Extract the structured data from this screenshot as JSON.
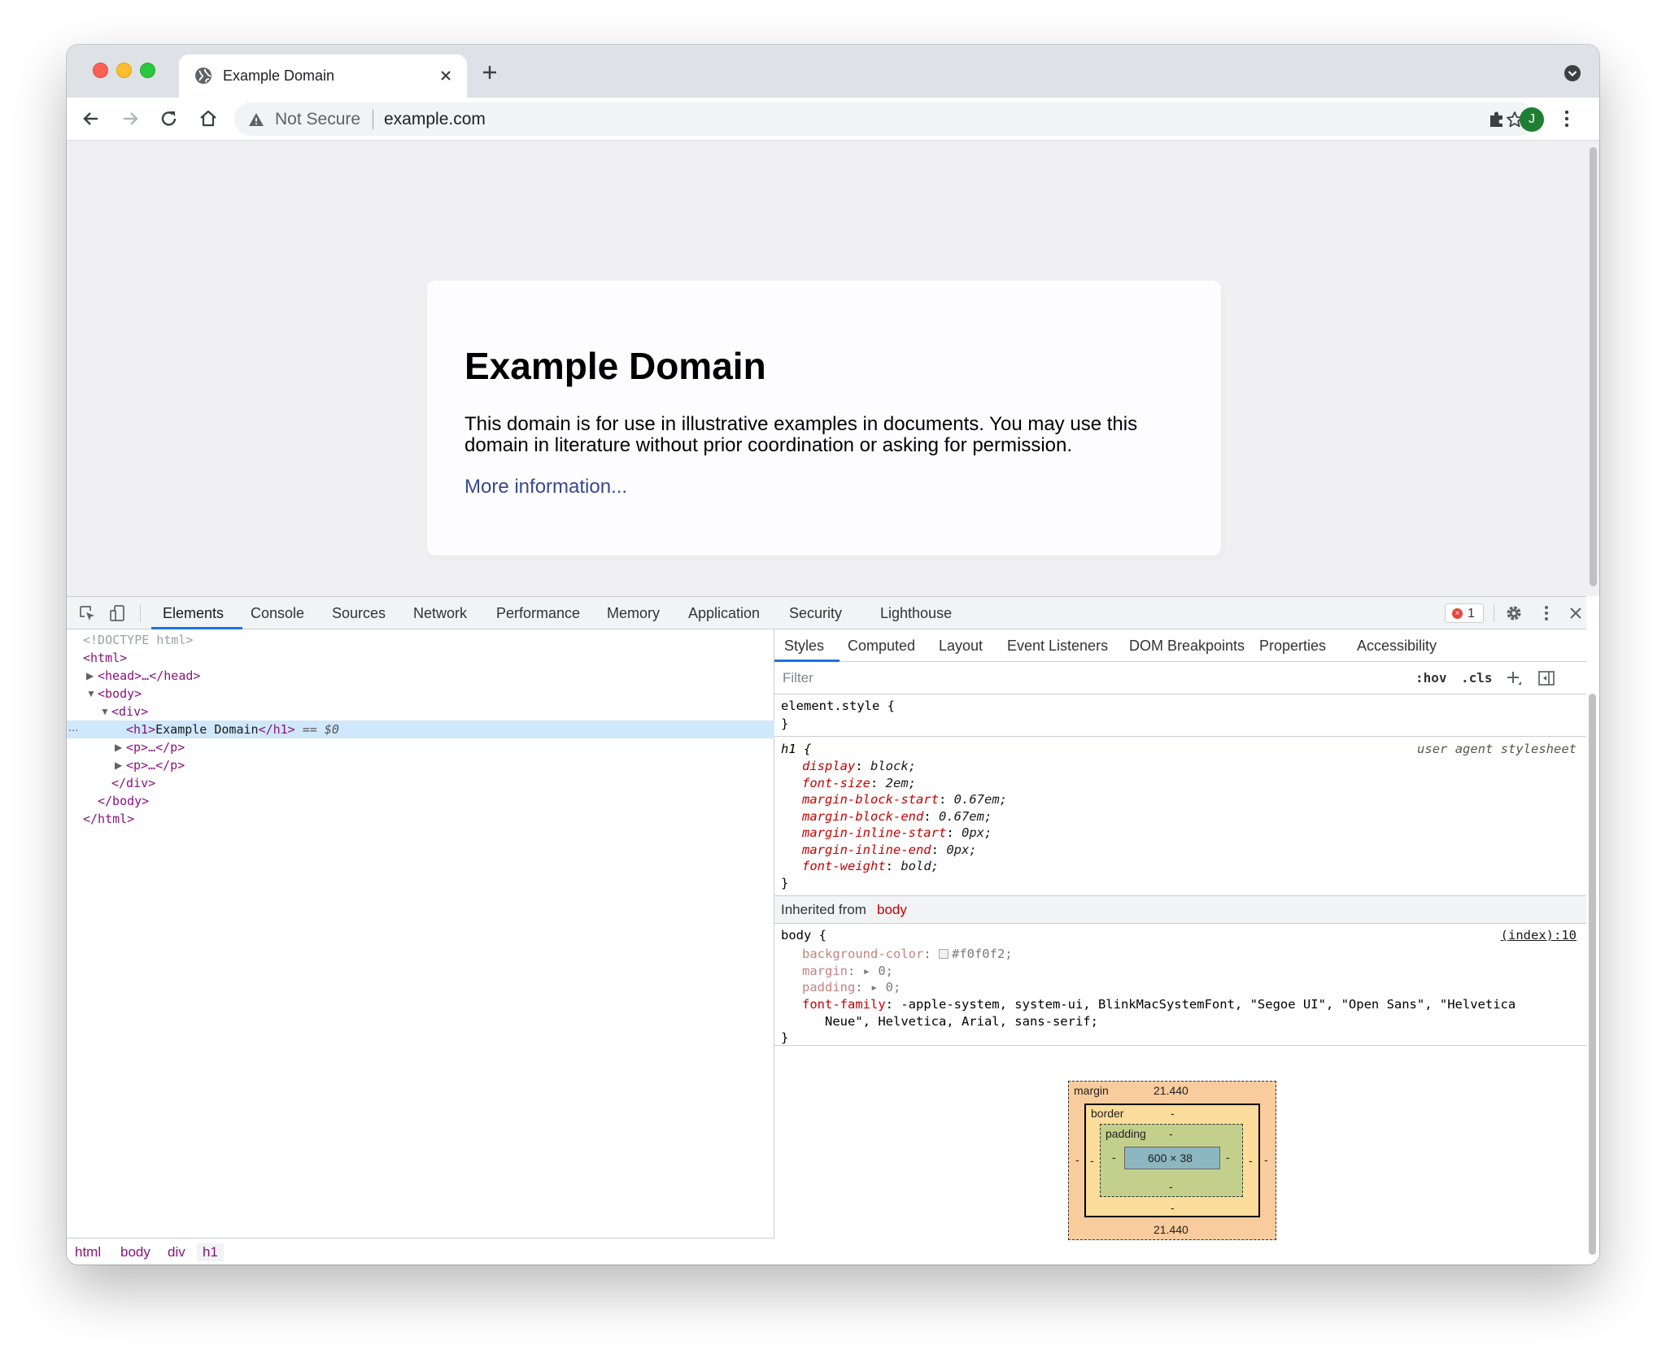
{
  "browser": {
    "tab_title": "Example Domain",
    "security_label": "Not Secure",
    "url": "example.com",
    "profile_initial": "J"
  },
  "page": {
    "heading": "Example Domain",
    "paragraph": "This domain is for use in illustrative examples in documents. You may use this domain in literature without prior coordination or asking for permission.",
    "link_text": "More information..."
  },
  "devtools": {
    "tabs": [
      "Elements",
      "Console",
      "Sources",
      "Network",
      "Performance",
      "Memory",
      "Application",
      "Security",
      "Lighthouse"
    ],
    "active_tab": "Elements",
    "error_count": "1",
    "dom": {
      "doctype": "<!DOCTYPE html>",
      "html_open": "<html>",
      "head": "<head>…</head>",
      "body_open": "<body>",
      "div_open": "<div>",
      "h1_open": "<h1>",
      "h1_text": "Example Domain",
      "h1_close": "</h1>",
      "selected_marker": "== $0",
      "p1": "<p>…</p>",
      "p2": "<p>…</p>",
      "div_close": "</div>",
      "body_close": "</body>",
      "html_close": "</html>",
      "ellipsis": "..."
    },
    "breadcrumbs": [
      "html",
      "body",
      "div",
      "h1"
    ],
    "styles": {
      "subtabs": [
        "Styles",
        "Computed",
        "Layout",
        "Event Listeners",
        "DOM Breakpoints",
        "Properties",
        "Accessibility"
      ],
      "filter_placeholder": "Filter",
      "hov": ":hov",
      "cls": ".cls",
      "element_style_open": "element.style {",
      "close_brace": "}",
      "h1_selector": "h1 {",
      "ua_label": "user agent stylesheet",
      "h1_props": [
        {
          "name": "display",
          "value": "block;"
        },
        {
          "name": "font-size",
          "value": "2em;"
        },
        {
          "name": "margin-block-start",
          "value": "0.67em;"
        },
        {
          "name": "margin-block-end",
          "value": "0.67em;"
        },
        {
          "name": "margin-inline-start",
          "value": "0px;"
        },
        {
          "name": "margin-inline-end",
          "value": "0px;"
        },
        {
          "name": "font-weight",
          "value": "bold;"
        }
      ],
      "inherited_label": "Inherited from",
      "inherited_from": "body",
      "body_selector": "body {",
      "body_source": "(index):10",
      "body_props": [
        {
          "name": "background-color",
          "value": "#f0f0f2;"
        },
        {
          "name": "margin",
          "value": "0;"
        },
        {
          "name": "padding",
          "value": "0;"
        },
        {
          "name": "font-family",
          "value": "-apple-system, system-ui, BlinkMacSystemFont, \"Segoe UI\", \"Open Sans\", \"Helvetica"
        },
        {
          "name": "",
          "value": "Neue\", Helvetica, Arial, sans-serif;"
        }
      ]
    },
    "box_model": {
      "margin_label": "margin",
      "margin_top": "21.440",
      "margin_bottom": "21.440",
      "border_label": "border",
      "padding_label": "padding",
      "content": "600 × 38",
      "dash": "-"
    }
  }
}
